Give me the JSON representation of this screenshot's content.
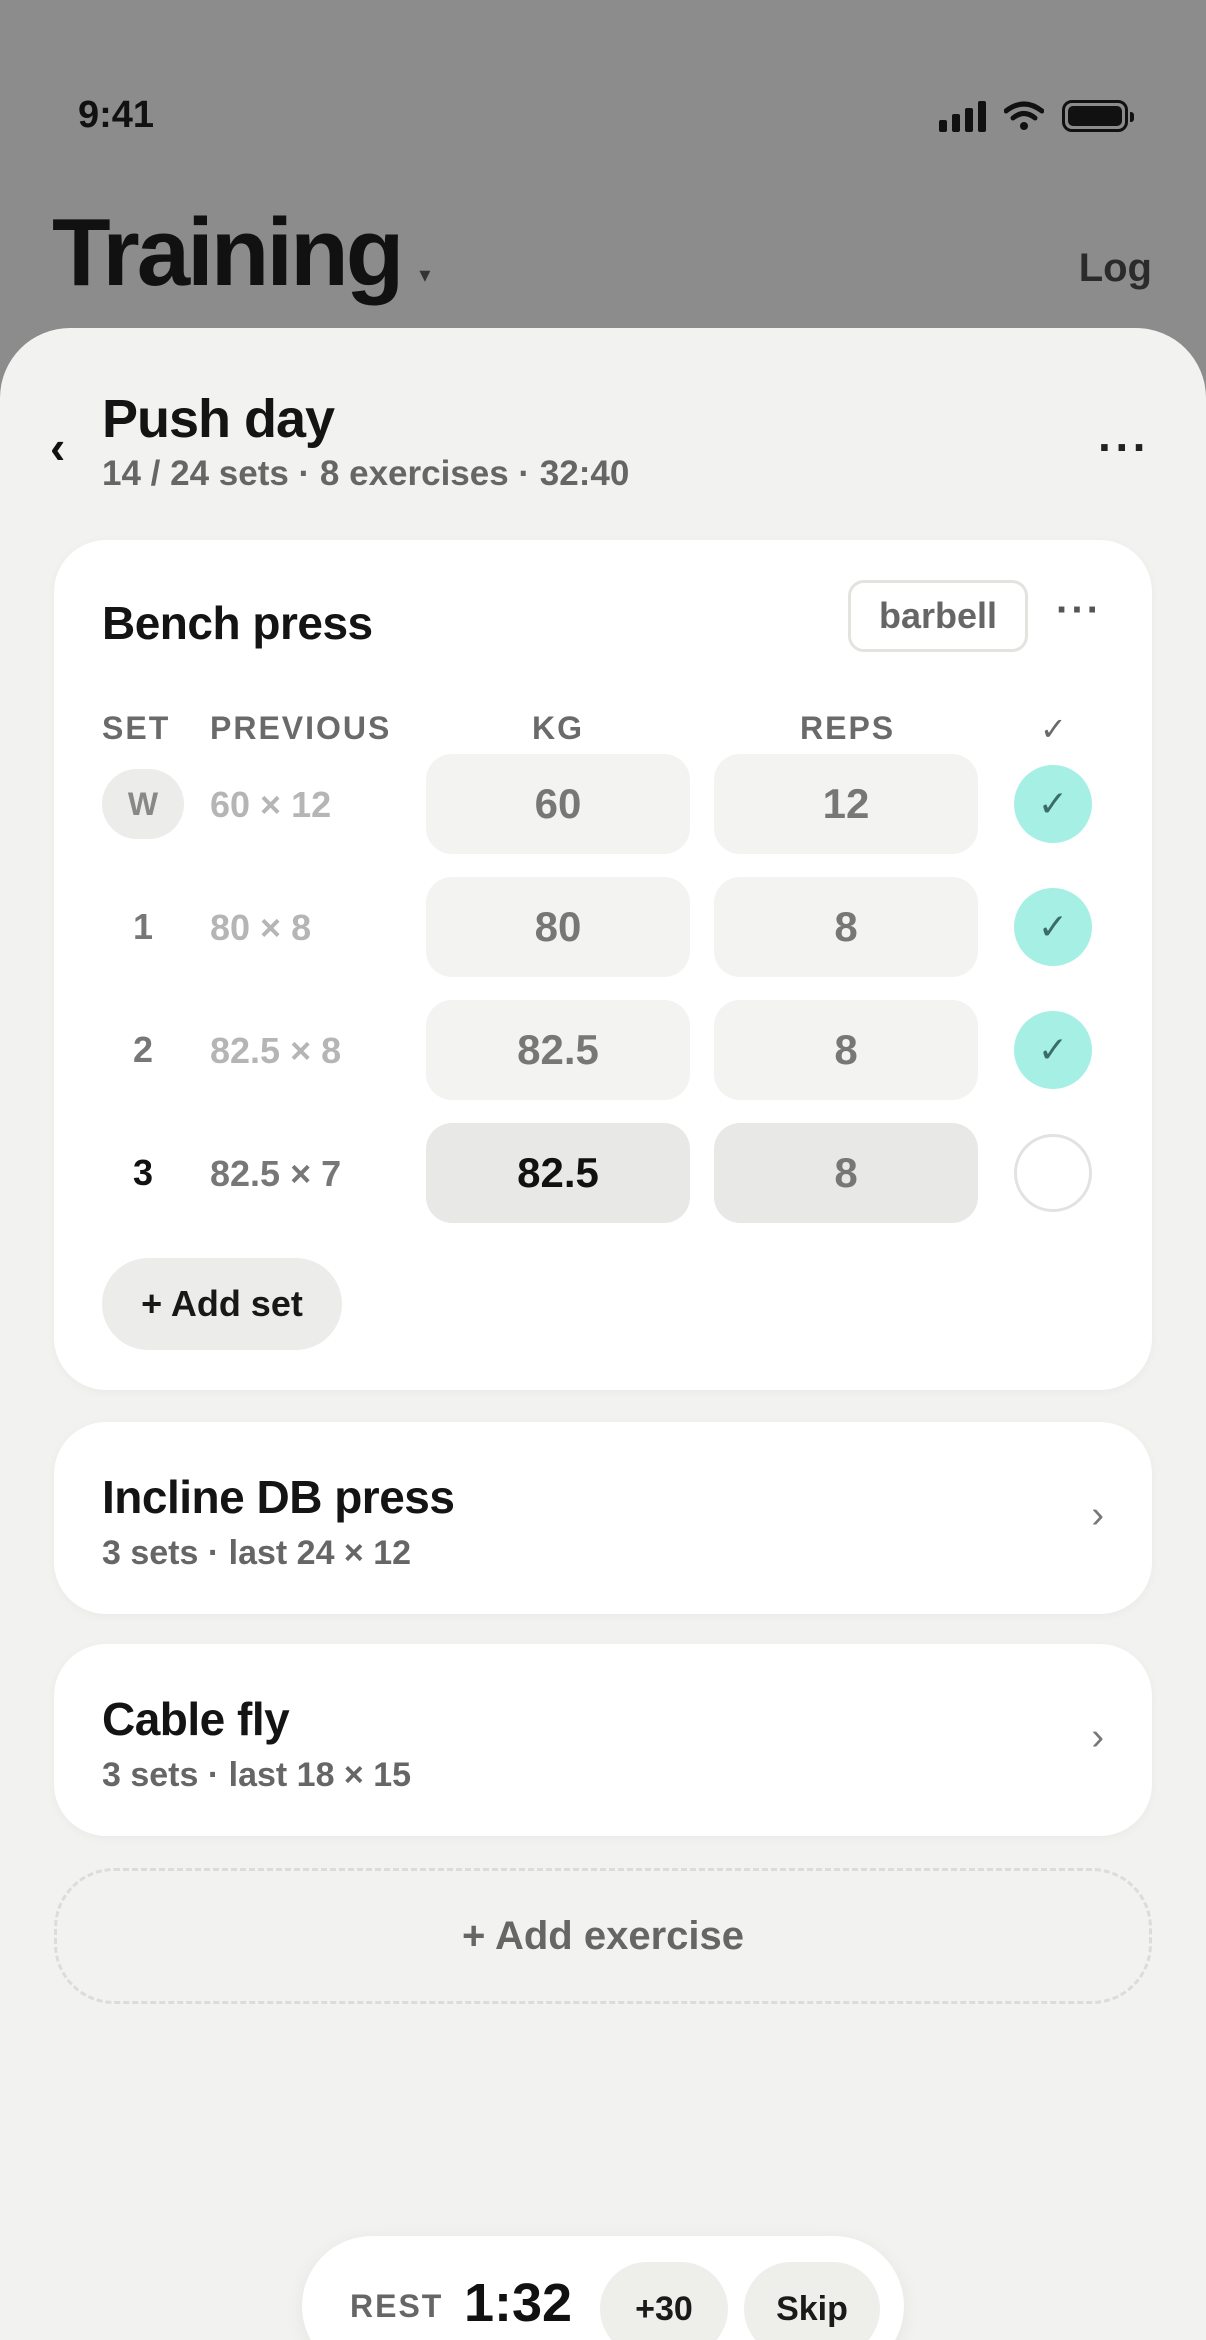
{
  "status": {
    "time": "9:41"
  },
  "header": {
    "title": "Training",
    "caret": "▾",
    "log_label": "Log"
  },
  "workout": {
    "back_glyph": "‹",
    "title": "Push day",
    "meta": "14 / 24 sets · 8 exercises · 32:40",
    "more_glyph": "···"
  },
  "bench": {
    "name": "Bench press",
    "equipment": "barbell",
    "more_glyph": "···",
    "columns": {
      "set": "SET",
      "previous": "PREVIOUS",
      "kg": "KG",
      "reps": "REPS",
      "done": "✓"
    },
    "rows": [
      {
        "set": "W",
        "previous": "60 × 12",
        "kg": "60",
        "reps": "12",
        "done": "✓"
      },
      {
        "set": "1",
        "previous": "80 × 8",
        "kg": "80",
        "reps": "8",
        "done": "✓"
      },
      {
        "set": "2",
        "previous": "82.5 × 8",
        "kg": "82.5",
        "reps": "8",
        "done": "✓"
      },
      {
        "set": "3",
        "previous": "82.5 × 7",
        "kg": "82.5",
        "reps": "8",
        "done": ""
      }
    ],
    "add_set_label": "+ Add set"
  },
  "exercises": [
    {
      "name": "Incline DB press",
      "sub": "3 sets · last 24 × 12",
      "chevron": "›"
    },
    {
      "name": "Cable fly",
      "sub": "3 sets · last 18 × 15",
      "chevron": "›"
    }
  ],
  "add_exercise_label": "+ Add exercise",
  "rest": {
    "label": "REST",
    "time": "1:32",
    "add_label": "+30",
    "skip_label": "Skip"
  },
  "colors": {
    "accent_check": "#a6efe5",
    "sheet_bg": "#f2f2f0",
    "backdrop": "#8c8c8c"
  }
}
